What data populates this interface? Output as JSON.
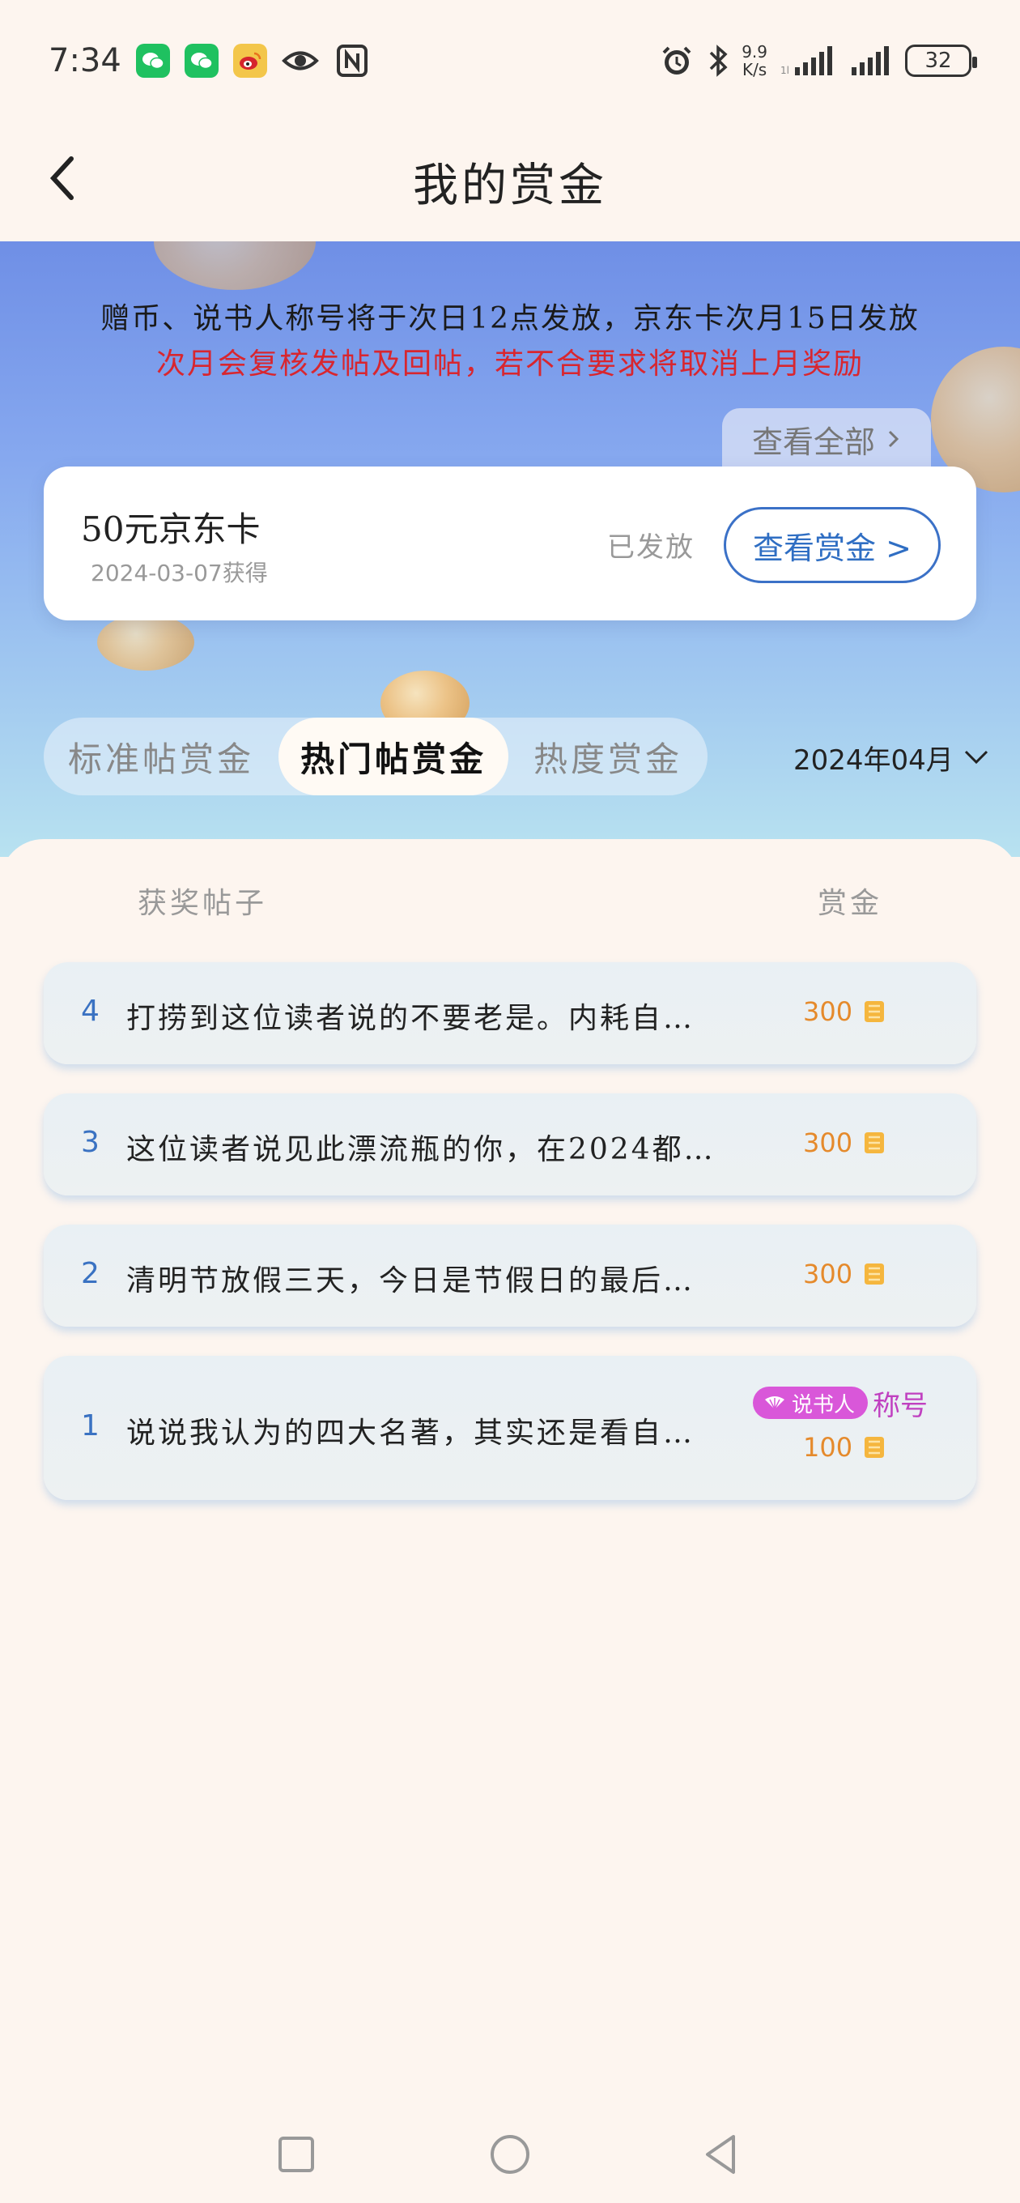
{
  "status_bar": {
    "time": "7:34",
    "speed": "9.9",
    "speed_unit": "K/s",
    "battery": "32"
  },
  "header": {
    "title": "我的赏金"
  },
  "notice": {
    "line1": "赠币、说书人称号将于次日12点发放，京东卡次月15日发放",
    "line2": "次月会复核发帖及回帖，若不合要求将取消上月奖励",
    "line2_color": "#d8262f"
  },
  "view_all": {
    "label": "查看全部"
  },
  "reward_card": {
    "name": "50元京东卡",
    "date": "2024-03-07获得",
    "status": "已发放",
    "button": "查看赏金 >"
  },
  "tabs": [
    {
      "label": "标准帖赏金",
      "active": false
    },
    {
      "label": "热门帖赏金",
      "active": true
    },
    {
      "label": "热度赏金",
      "active": false
    }
  ],
  "month": {
    "label": "2024年04月"
  },
  "table": {
    "col_post": "获奖帖子",
    "col_reward": "赏金",
    "rows": [
      {
        "rank": "4",
        "text": "打捞到这位读者说的不要老是。内耗自…",
        "amount": "300"
      },
      {
        "rank": "3",
        "text": "这位读者说见此漂流瓶的你，在2024都…",
        "amount": "300"
      },
      {
        "rank": "2",
        "text": "清明节放假三天，今日是节假日的最后…",
        "amount": "300"
      },
      {
        "rank": "1",
        "text": "说说我认为的四大名著，其实还是看自…",
        "amount": "100",
        "tag": "说书人",
        "tag_suffix": "称号"
      }
    ]
  },
  "colors": {
    "accent": "#2f6ec3",
    "amount": "#e58a2c",
    "tag": "#d957d9"
  }
}
